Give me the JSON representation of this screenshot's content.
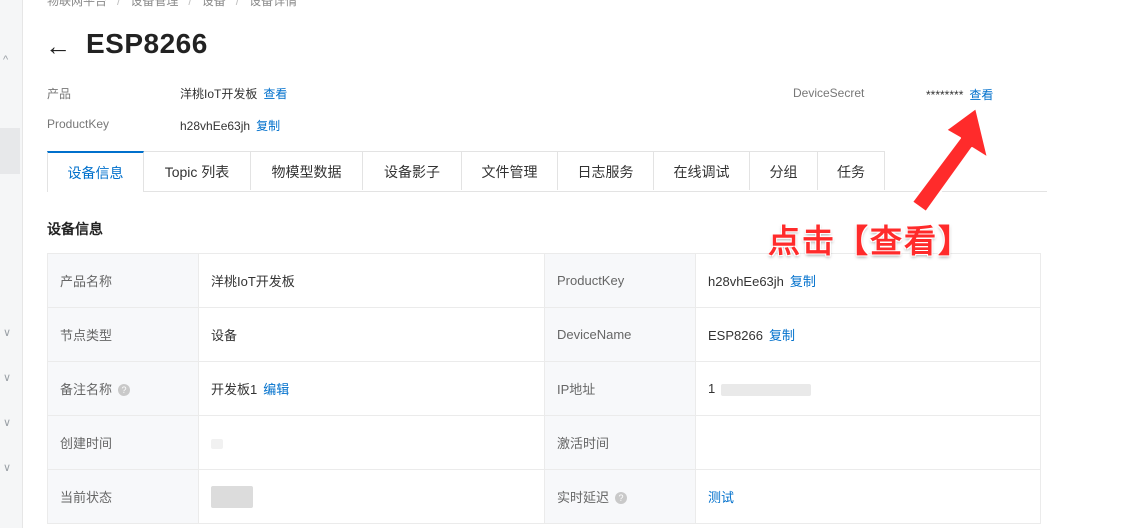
{
  "breadcrumb": [
    "物联网平台",
    "设备管理",
    "设备",
    "设备详情"
  ],
  "title": "ESP8266",
  "header": {
    "product_label": "产品",
    "product_value": "洋桃IoT开发板",
    "product_link": "查看",
    "productkey_label": "ProductKey",
    "productkey_value": "h28vhEe63jh",
    "productkey_link": "复制",
    "devicesecret_label": "DeviceSecret",
    "devicesecret_value": "********",
    "devicesecret_link": "查看"
  },
  "tabs": [
    "设备信息",
    "Topic 列表",
    "物模型数据",
    "设备影子",
    "文件管理",
    "日志服务",
    "在线调试",
    "分组",
    "任务"
  ],
  "active_tab": "设备信息",
  "section_title": "设备信息",
  "info": {
    "product_name_label": "产品名称",
    "product_name_value": "洋桃IoT开发板",
    "productkey_label": "ProductKey",
    "productkey_value": "h28vhEe63jh",
    "productkey_link": "复制",
    "node_type_label": "节点类型",
    "node_type_value": "设备",
    "devicename_label": "DeviceName",
    "devicename_value": "ESP8266",
    "devicename_link": "复制",
    "remark_label": "备注名称",
    "remark_value": "开发板1",
    "remark_link": "编辑",
    "ip_label": "IP地址",
    "ip_value": "1",
    "created_label": "创建时间",
    "activated_label": "激活时间",
    "status_label": "当前状态",
    "latency_label": "实时延迟",
    "latency_link": "测试"
  },
  "annotation": {
    "text": "点击【查看】",
    "color": "#ff2b2b"
  },
  "colors": {
    "link": "#0070cc",
    "accent": "#0070cc"
  }
}
